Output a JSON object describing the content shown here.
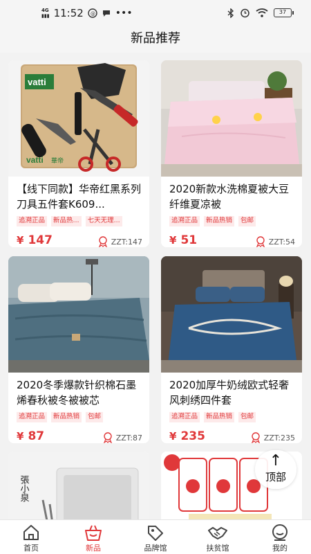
{
  "status": {
    "time": "11:52",
    "network": "4G",
    "battery": "37"
  },
  "header": {
    "title": "新品推荐"
  },
  "products": [
    {
      "name": "【线下同款】华帝红黑系列刀具五件套K609...",
      "tags": [
        "追溯正品",
        "新品热...",
        "七天无理..."
      ],
      "price": "147",
      "currency": "¥",
      "zzt": "ZZT:147",
      "image_brand": "vatti",
      "image_brand_cn": "華帝"
    },
    {
      "name": "2020新款水洗棉夏被大豆纤维夏凉被",
      "tags": [
        "追溯正品",
        "新品热销",
        "包邮"
      ],
      "price": "51",
      "currency": "¥",
      "zzt": "ZZT:54"
    },
    {
      "name": "2020冬季爆款针织棉石墨烯春秋被冬被被芯",
      "tags": [
        "追溯正品",
        "新品热销",
        "包邮"
      ],
      "price": "87",
      "currency": "¥",
      "zzt": "ZZT:87"
    },
    {
      "name": "2020加厚牛奶绒欧式轻奢风刺绣四件套",
      "tags": [
        "追溯正品",
        "新品热销",
        "包邮"
      ],
      "price": "235",
      "currency": "¥",
      "zzt": "ZZT:235"
    },
    {
      "name": "",
      "tags": [],
      "price": "",
      "currency": "",
      "zzt": "",
      "image_brand_cn": "張小泉"
    },
    {
      "name": "",
      "tags": [],
      "price": "",
      "currency": "",
      "zzt": ""
    }
  ],
  "to_top": {
    "label": "顶部"
  },
  "tabs": [
    {
      "label": "首页",
      "icon": "home-icon"
    },
    {
      "label": "新品",
      "icon": "basket-icon",
      "active": true
    },
    {
      "label": "品牌馆",
      "icon": "tag-icon"
    },
    {
      "label": "扶贫馆",
      "icon": "handshake-icon"
    },
    {
      "label": "我的",
      "icon": "profile-icon"
    }
  ],
  "colors": {
    "accent": "#e0383a",
    "tag_bg": "#fdeaea",
    "page_bg": "#f2f2f2"
  }
}
